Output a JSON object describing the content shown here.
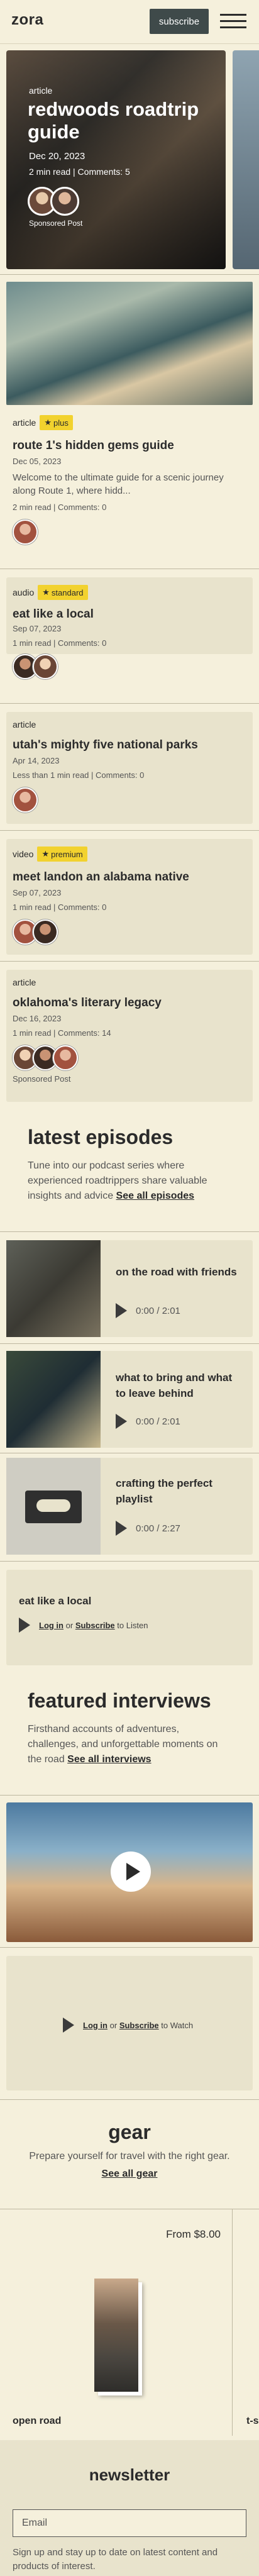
{
  "header": {
    "logo": "zora",
    "subscribe_label": "subscribe"
  },
  "hero": {
    "category": "article",
    "title": "redwoods roadtrip guide",
    "date": "Dec 20, 2023",
    "meta": "2 min read | Comments: 5",
    "sponsored": "Sponsored Post"
  },
  "articles": [
    {
      "category": "article",
      "badge": "plus",
      "title": "route 1's hidden gems guide",
      "date": "Dec 05, 2023",
      "desc": "Welcome to the ultimate guide for a scenic journey along Route 1, where hidd...",
      "meta": "2 min read | Comments: 0"
    },
    {
      "category": "audio",
      "badge": "standard",
      "title": "eat like a local",
      "date": "Sep 07, 2023",
      "meta": "1 min read | Comments: 0"
    },
    {
      "category": "article",
      "title": "utah's mighty five national parks",
      "date": "Apr 14, 2023",
      "meta": "Less than 1 min read | Comments: 0"
    },
    {
      "category": "video",
      "badge": "premium",
      "title": "meet landon an alabama native",
      "date": "Sep 07, 2023",
      "meta": "1 min read | Comments: 0"
    },
    {
      "category": "article",
      "title": "oklahoma's literary legacy",
      "date": "Dec 16, 2023",
      "meta": "1 min read | Comments: 14",
      "sponsored": "Sponsored Post"
    }
  ],
  "podcasts": {
    "title": "latest episodes",
    "sub": "Tune into our podcast series where experienced roadtrippers share valuable insights and advice",
    "link": "See all episodes",
    "episodes": [
      {
        "title": "on the road with friends",
        "time": "0:00 / 2:01"
      },
      {
        "title": "what to bring and what to leave behind",
        "time": "0:00 / 2:01"
      },
      {
        "title": "crafting the perfect playlist",
        "time": "0:00 / 2:27"
      }
    ]
  },
  "audio_promo": {
    "title": "eat like a local",
    "login": "Log in",
    "or": "or",
    "subscribe": "Subscribe",
    "action": "to Listen"
  },
  "interviews": {
    "title": "featured interviews",
    "sub": "Firsthand accounts of adventures, challenges, and unforgettable moments on the road",
    "link": "See all interviews"
  },
  "video_promo": {
    "login": "Log in",
    "or": "or",
    "subscribe": "Subscribe",
    "action": "to Watch"
  },
  "gear": {
    "title": "gear",
    "sub": "Prepare yourself for travel with the right gear.",
    "link": "See all gear",
    "product_price": "From $8.00",
    "product_name": "open road",
    "next_name": "t-s"
  },
  "newsletter": {
    "title": "newsletter",
    "placeholder": "Email",
    "text": "Sign up and stay up to date on latest content and products of interest."
  }
}
